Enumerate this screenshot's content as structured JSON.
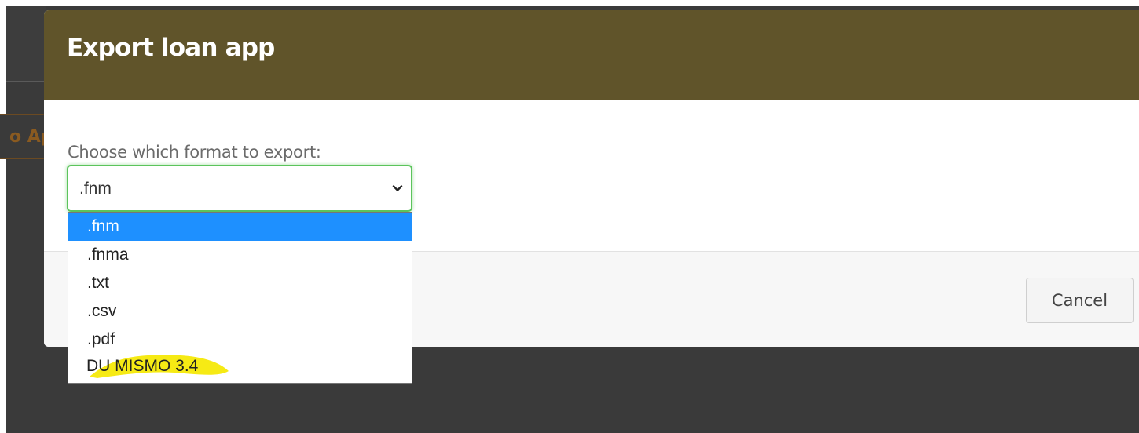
{
  "dialog": {
    "title": "Export loan app",
    "prompt": "Choose which format to export:",
    "cancel_label": "Cancel"
  },
  "background": {
    "peek_text": "o Ap"
  },
  "format_select": {
    "selected_value": ".fnm",
    "options": [
      ".fnm",
      ".fnma",
      ".txt",
      ".csv",
      ".pdf",
      "DU MISMO 3.4"
    ],
    "highlighted_option": "DU MISMO 3.4"
  },
  "colors": {
    "header": "#60542a",
    "option_selected": "#1e90ff",
    "focus_border": "#5cc45c",
    "marker_highlight": "#f5e800"
  },
  "icons": {
    "select_arrow": "chevron-down-icon"
  }
}
